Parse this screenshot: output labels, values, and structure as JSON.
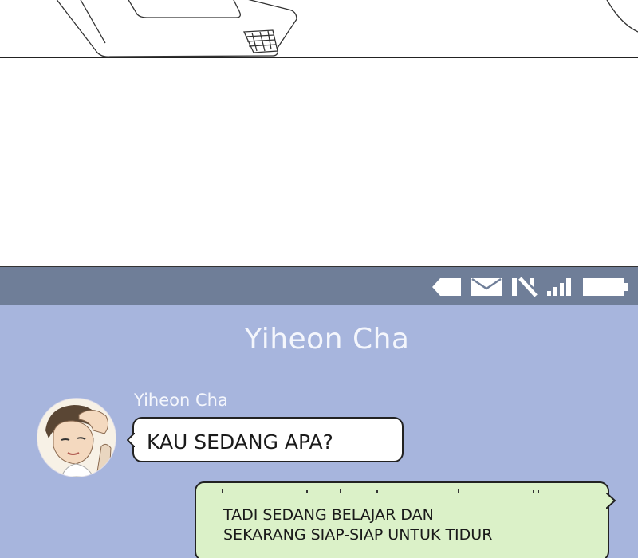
{
  "status_bar": {
    "icons": [
      "back-tag-icon",
      "mail-icon",
      "no-network-icon",
      "signal-icon",
      "battery-icon"
    ],
    "background": "#6f7e98"
  },
  "chat": {
    "title": "Yiheon Cha",
    "background": "#a7b5dd",
    "messages": [
      {
        "sender": "Yiheon Cha",
        "text": "KAU SEDANG APA?",
        "direction": "received"
      },
      {
        "text_line1": "TADI SEDANG BELAJAR DAN",
        "text_line2": "SEKARANG SIAP-SIAP UNTUK TIDUR",
        "direction": "sent"
      }
    ]
  }
}
